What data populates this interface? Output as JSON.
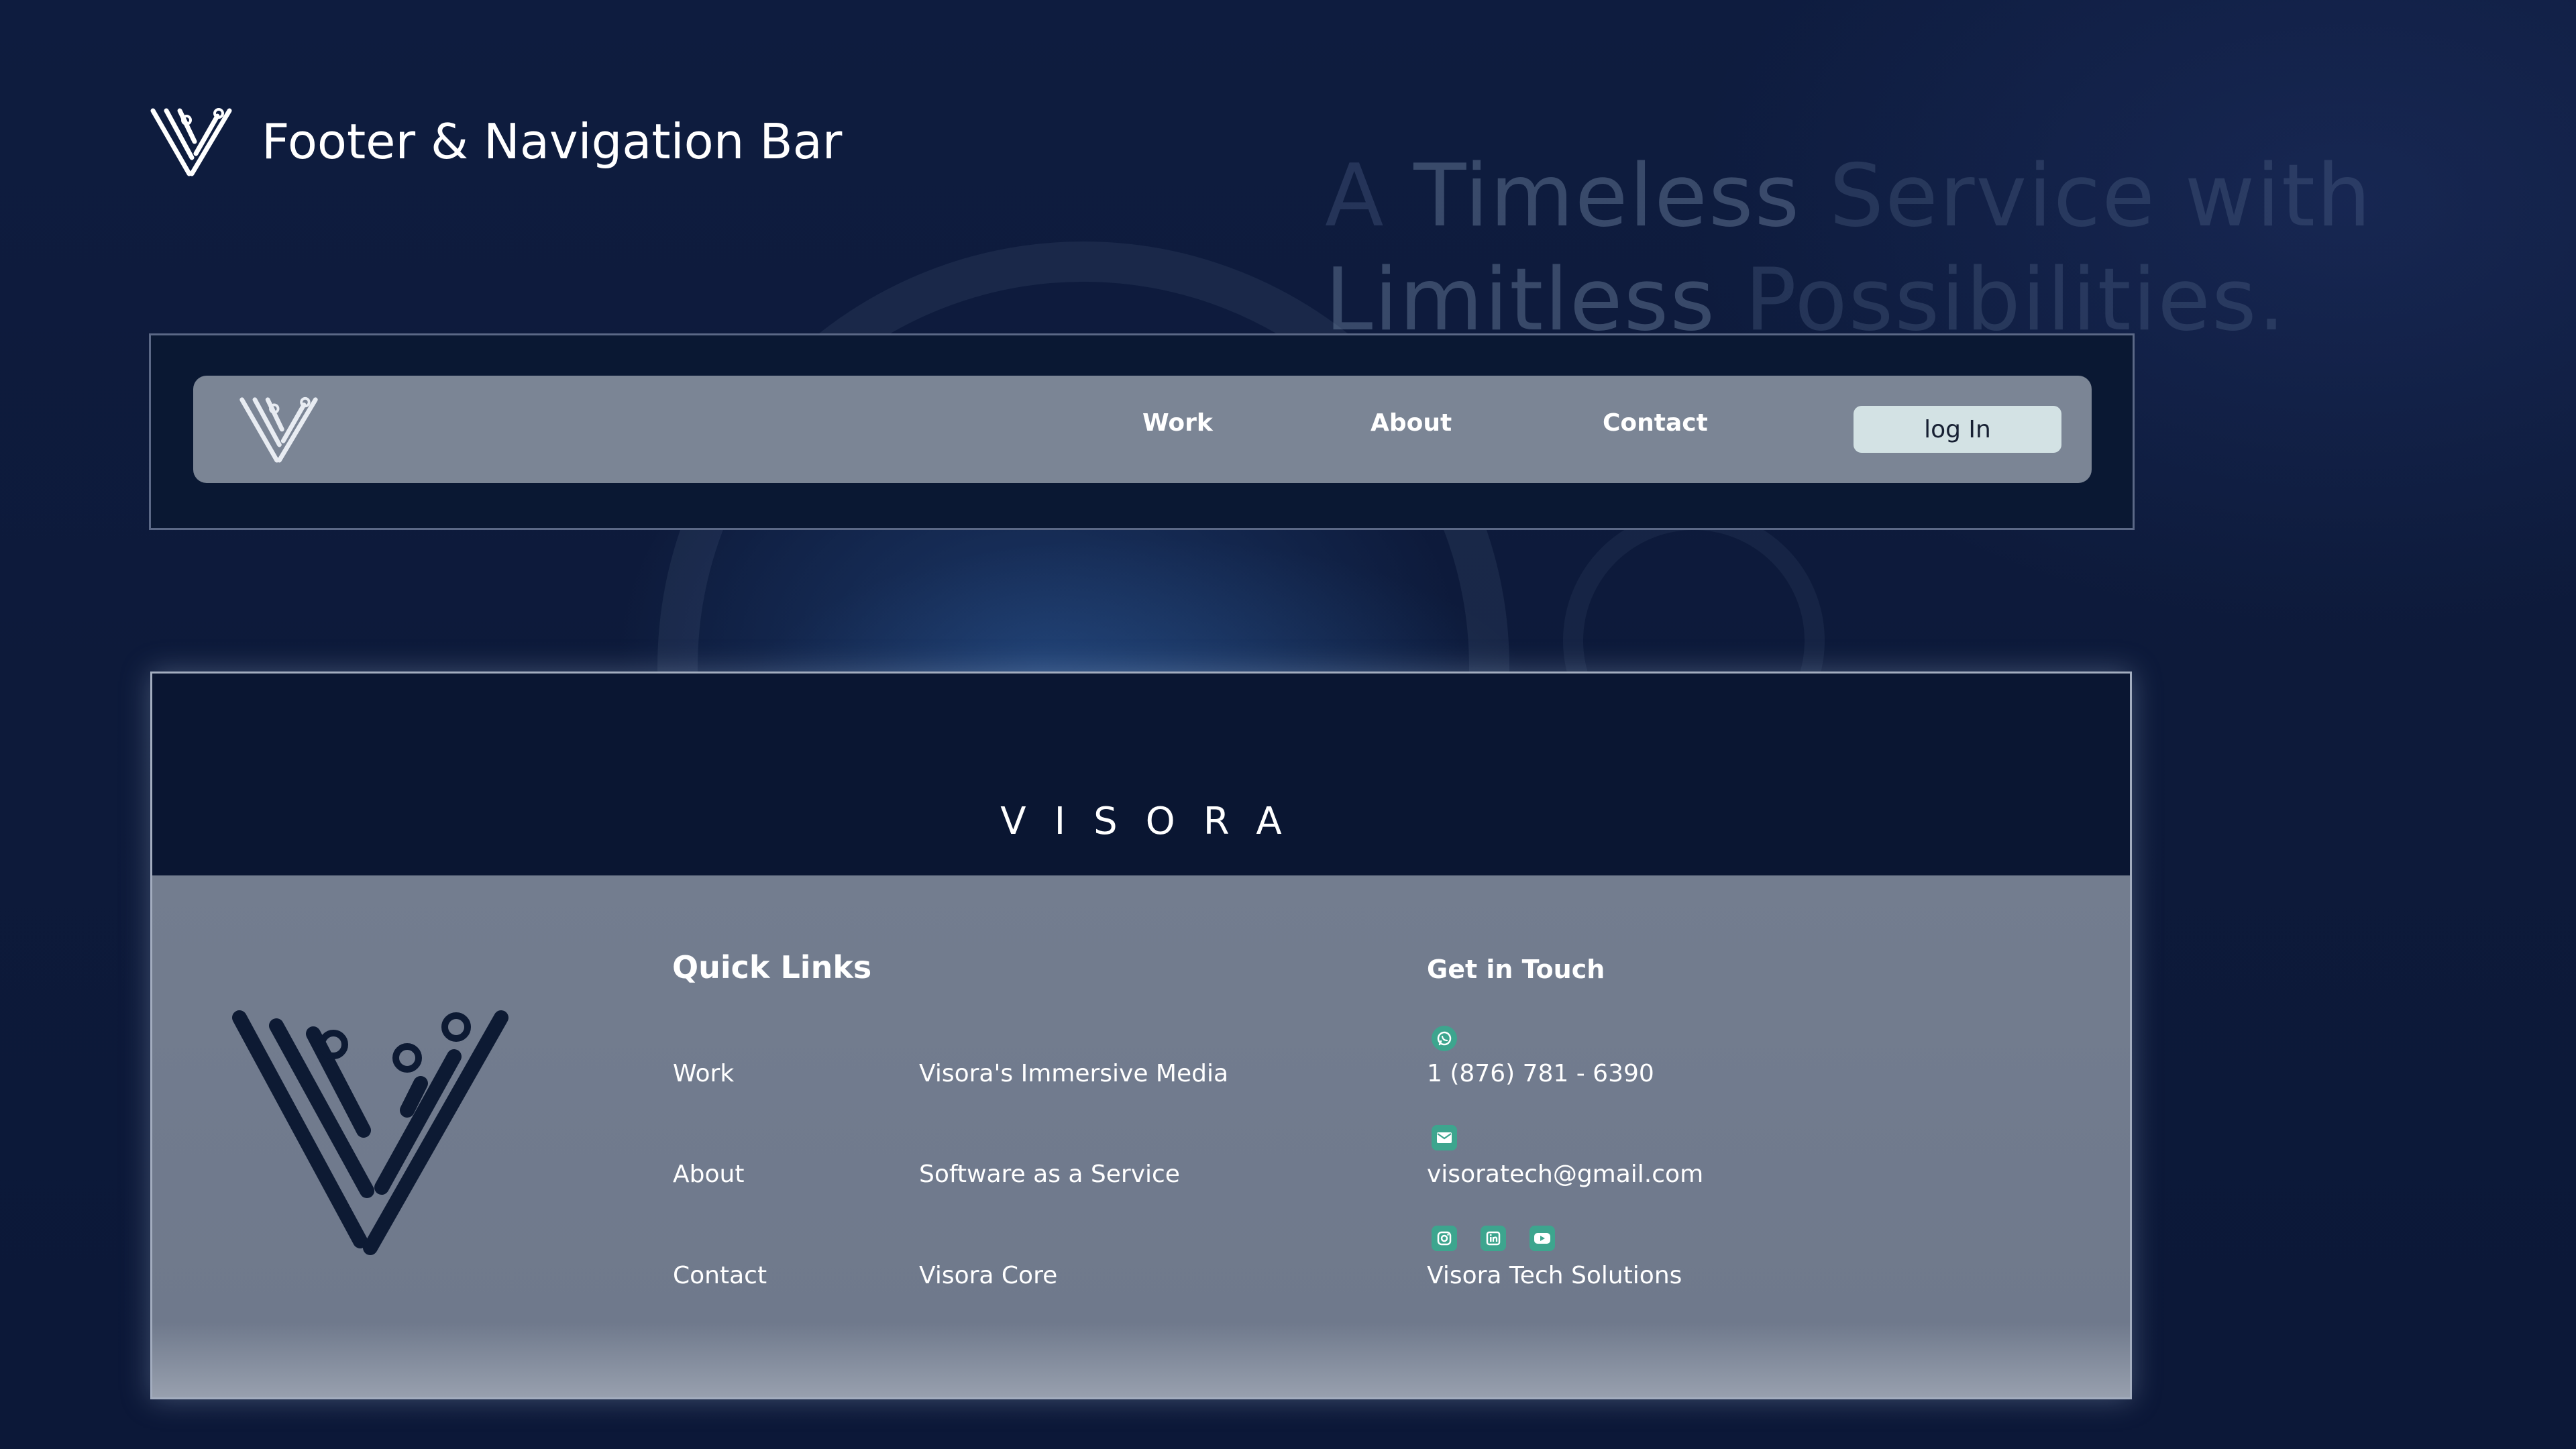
{
  "header": {
    "title": "Footer & Navigation Bar"
  },
  "tagline": {
    "line1_a": "A ",
    "line1_b": "Timeless",
    "line1_c": " Service with",
    "line2_a": "Limitless",
    "line2_b": " Possibilities."
  },
  "navbar": {
    "links": [
      {
        "label": "Work"
      },
      {
        "label": "About"
      },
      {
        "label": "Contact"
      }
    ],
    "login_label": "log In"
  },
  "footer": {
    "wordmark": "VISORA",
    "quick_links": {
      "heading": "Quick Links",
      "col1": [
        "Work",
        "About",
        "Contact"
      ],
      "col2": [
        "Visora's Immersive Media",
        "Software as a Service",
        "Visora Core"
      ]
    },
    "get_in_touch": {
      "heading": "Get in Touch",
      "phone": "1 (876) 781 - 6390",
      "email": "visoratech@gmail.com",
      "social_name": "Visora Tech Solutions"
    },
    "icons": {
      "phone": "whatsapp-icon",
      "email": "mail-icon",
      "social": [
        "instagram-icon",
        "linkedin-icon",
        "youtube-icon"
      ]
    }
  },
  "colors": {
    "background": "#0e1c3f",
    "navbar": "#7b8595",
    "login_button": "#d3e2e4",
    "footer_top": "#0a1632",
    "footer_body": "#737d8f",
    "icon_accent": "#3da58e"
  }
}
